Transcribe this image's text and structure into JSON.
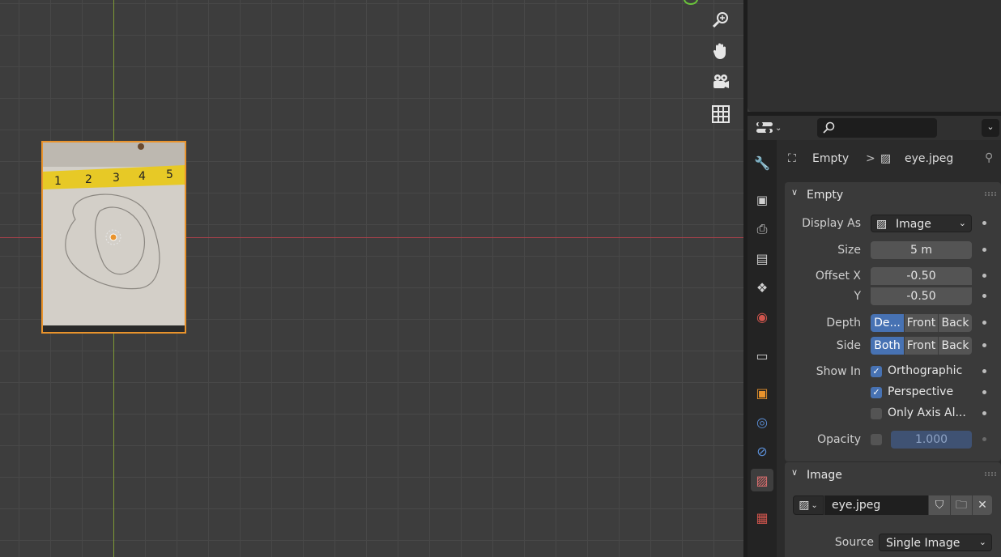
{
  "viewport": {
    "nav_buttons": [
      {
        "icon": "zoom-icon",
        "glyph": "⌕"
      },
      {
        "icon": "hand-pan-icon",
        "glyph": "✋"
      },
      {
        "icon": "camera-icon",
        "glyph": "🎥"
      },
      {
        "icon": "grid-icon",
        "glyph": "▦"
      }
    ],
    "ruler_marks": [
      "1",
      "2",
      "3",
      "4",
      "5"
    ]
  },
  "properties": {
    "breadcrumb": {
      "object": "Empty",
      "separator": ">",
      "data": "eye.jpeg"
    },
    "empty_panel": {
      "title": "Empty",
      "display_as_label": "Display As",
      "display_as_value": "Image",
      "size_label": "Size",
      "size_value": "5 m",
      "offset_x_label": "Offset X",
      "offset_x_value": "-0.50",
      "offset_y_label": "Y",
      "offset_y_value": "-0.50",
      "depth_label": "Depth",
      "depth_options": [
        "De...",
        "Front",
        "Back"
      ],
      "side_label": "Side",
      "side_options": [
        "Both",
        "Front",
        "Back"
      ],
      "show_in_label": "Show In",
      "show_in_options": [
        {
          "label": "Orthographic",
          "checked": true
        },
        {
          "label": "Perspective",
          "checked": true
        },
        {
          "label": "Only Axis Al...",
          "checked": false
        }
      ],
      "opacity_label": "Opacity",
      "opacity_value": "1.000"
    },
    "image_panel": {
      "title": "Image",
      "image_name": "eye.jpeg",
      "source_label": "Source",
      "source_value": "Single Image"
    }
  },
  "colors": {
    "accent": "#4772b3",
    "selection_outline": "#e9932c",
    "x_axis": "#a3414a",
    "y_axis": "#7e9a36"
  }
}
